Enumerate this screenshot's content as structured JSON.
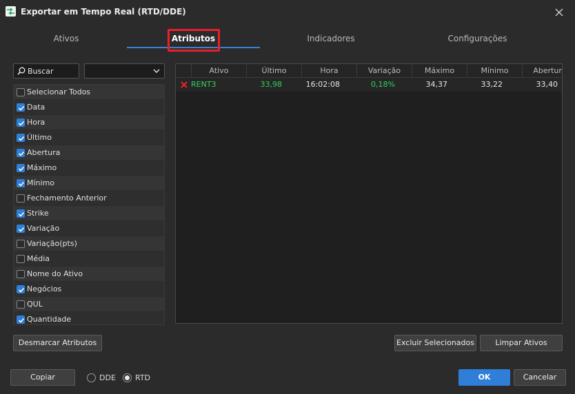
{
  "window": {
    "title": "Exportar em Tempo Real (RTD/DDE)"
  },
  "tabs": [
    {
      "label": "Ativos",
      "active": false
    },
    {
      "label": "Atributos",
      "active": true
    },
    {
      "label": "Indicadores",
      "active": false
    },
    {
      "label": "Configurações",
      "active": false
    }
  ],
  "search": {
    "placeholder": "Buscar",
    "value": ""
  },
  "filter": {
    "value": ""
  },
  "attributes": [
    {
      "label": "Selecionar Todos",
      "checked": false
    },
    {
      "label": "Data",
      "checked": true
    },
    {
      "label": "Hora",
      "checked": true
    },
    {
      "label": "Último",
      "checked": true
    },
    {
      "label": "Abertura",
      "checked": true
    },
    {
      "label": "Máximo",
      "checked": true
    },
    {
      "label": "Mínimo",
      "checked": true
    },
    {
      "label": "Fechamento Anterior",
      "checked": false
    },
    {
      "label": "Strike",
      "checked": true
    },
    {
      "label": "Variação",
      "checked": true
    },
    {
      "label": "Variação(pts)",
      "checked": false
    },
    {
      "label": "Média",
      "checked": false
    },
    {
      "label": "Nome do Ativo",
      "checked": false
    },
    {
      "label": "Negócios",
      "checked": true
    },
    {
      "label": "QUL",
      "checked": false
    },
    {
      "label": "Quantidade",
      "checked": true
    }
  ],
  "grid": {
    "columns": [
      "Ativo",
      "Último",
      "Hora",
      "Variação",
      "Máximo",
      "Mínimo",
      "Abertura"
    ],
    "rows": [
      {
        "ativo": "RENT3",
        "ultimo": "33,98",
        "hora": "16:02:08",
        "variacao": "0,18%",
        "maximo": "34,37",
        "minimo": "33,22",
        "abertura": "33,40"
      }
    ]
  },
  "buttons": {
    "desmarcar": "Desmarcar Atributos",
    "excluir": "Excluir Selecionados",
    "limpar": "Limpar Ativos",
    "copiar": "Copiar",
    "ok": "OK",
    "cancelar": "Cancelar"
  },
  "mode": {
    "options": [
      "DDE",
      "RTD"
    ],
    "selected": "RTD"
  },
  "colors": {
    "accent": "#2f7fd9",
    "positive": "#2fd35a",
    "remove": "#e8202a",
    "highlight": "#e8202a"
  }
}
